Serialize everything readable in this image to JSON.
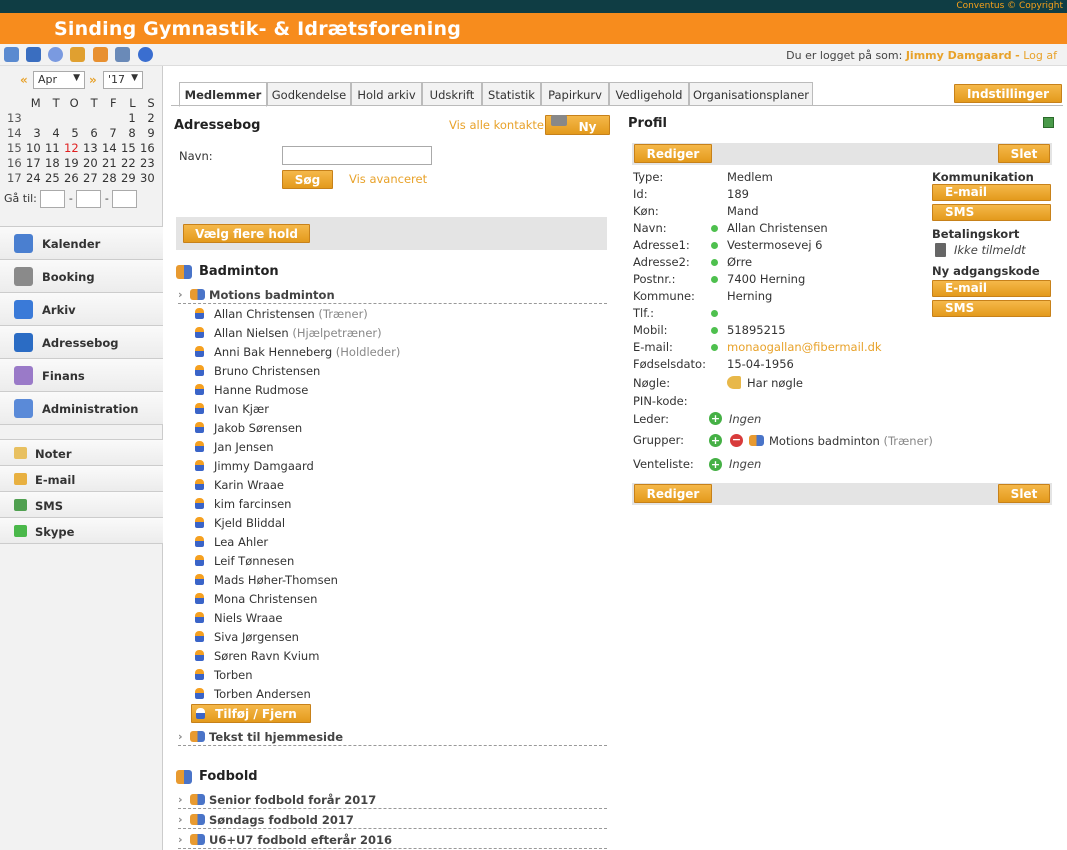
{
  "header": {
    "copyright": "Conventus © Copyright",
    "brand": "Sinding Gymnastik- & Idrætsforening",
    "login_prefix": "Du er logget på som:",
    "user": "Jimmy Damgaard",
    "logout_sep": "-",
    "logout": "Log af"
  },
  "toolbar": {
    "icons": [
      "calendar-grid-icon",
      "swap-arrows-icon",
      "gear-icon",
      "home-icon",
      "refresh-icon",
      "monitor-icon",
      "help-icon"
    ]
  },
  "calendar": {
    "prev": "«",
    "next": "»",
    "month": "Apr",
    "year": "'17",
    "weekdays": [
      "M",
      "T",
      "O",
      "T",
      "F",
      "L",
      "S"
    ],
    "weeks": [
      {
        "wk": "13",
        "days": [
          "",
          "",
          "",
          "",
          "",
          "1",
          "2"
        ]
      },
      {
        "wk": "14",
        "days": [
          "3",
          "4",
          "5",
          "6",
          "7",
          "8",
          "9"
        ]
      },
      {
        "wk": "15",
        "days": [
          "10",
          "11",
          "12",
          "13",
          "14",
          "15",
          "16"
        ]
      },
      {
        "wk": "16",
        "days": [
          "17",
          "18",
          "19",
          "20",
          "21",
          "22",
          "23"
        ]
      },
      {
        "wk": "17",
        "days": [
          "24",
          "25",
          "26",
          "27",
          "28",
          "29",
          "30"
        ]
      }
    ],
    "today": "12",
    "goto_label": "Gå til:",
    "goto_sep": "-"
  },
  "nav": {
    "main": [
      {
        "label": "Kalender",
        "icon": "calendar-icon",
        "color": "#4a7fd0"
      },
      {
        "label": "Booking",
        "icon": "booking-icon",
        "color": "#8a8a8a"
      },
      {
        "label": "Arkiv",
        "icon": "archive-icon",
        "color": "#3a7ad8"
      },
      {
        "label": "Adressebog",
        "icon": "addressbook-icon",
        "color": "#2b6cc4"
      },
      {
        "label": "Finans",
        "icon": "finance-icon",
        "color": "#9a7ac8"
      },
      {
        "label": "Administration",
        "icon": "admin-icon",
        "color": "#5a8ad8"
      }
    ],
    "secondary": [
      {
        "label": "Noter",
        "icon": "notes-icon",
        "color": "#e8c060"
      },
      {
        "label": "E-mail",
        "icon": "email-icon",
        "color": "#e8b040"
      },
      {
        "label": "SMS",
        "icon": "sms-icon",
        "color": "#50a050"
      },
      {
        "label": "Skype",
        "icon": "skype-icon",
        "color": "#4ab84a"
      }
    ]
  },
  "tabs": [
    "Medlemmer",
    "Godkendelse",
    "Hold arkiv",
    "Udskrift",
    "Statistik",
    "Papirkurv",
    "Vedligehold",
    "Organisationsplaner"
  ],
  "settings_button": "Indstillinger",
  "addressbook": {
    "title": "Adressebog",
    "show_all": "Vis alle kontakter",
    "new": "Ny",
    "name_label": "Navn:",
    "name_value": "",
    "search": "Søg",
    "advanced": "Vis avanceret",
    "select_multiple": "Vælg flere hold"
  },
  "groups": [
    {
      "title": "Badminton",
      "subgroups": [
        {
          "name": "Motions badminton",
          "members": [
            {
              "name": "Allan Christensen",
              "role": "(Træner)"
            },
            {
              "name": "Allan Nielsen",
              "role": "(Hjælpetræner)"
            },
            {
              "name": "Anni Bak Henneberg",
              "role": "(Holdleder)"
            },
            {
              "name": "Bruno Christensen",
              "role": ""
            },
            {
              "name": "Hanne Rudmose",
              "role": ""
            },
            {
              "name": "Ivan Kjær",
              "role": ""
            },
            {
              "name": "Jakob Sørensen",
              "role": ""
            },
            {
              "name": "Jan Jensen",
              "role": ""
            },
            {
              "name": "Jimmy Damgaard",
              "role": ""
            },
            {
              "name": "Karin Wraae",
              "role": ""
            },
            {
              "name": "kim farcinsen",
              "role": ""
            },
            {
              "name": "Kjeld Bliddal",
              "role": ""
            },
            {
              "name": "Lea Ahler",
              "role": ""
            },
            {
              "name": "Leif Tønnesen",
              "role": ""
            },
            {
              "name": "Mads Høher-Thomsen",
              "role": ""
            },
            {
              "name": "Mona Christensen",
              "role": ""
            },
            {
              "name": "Niels Wraae",
              "role": ""
            },
            {
              "name": "Siva Jørgensen",
              "role": ""
            },
            {
              "name": "Søren Ravn Kvium",
              "role": ""
            },
            {
              "name": "Torben",
              "role": ""
            },
            {
              "name": "Torben Andersen",
              "role": ""
            }
          ],
          "add_remove": "Tilføj / Fjern"
        },
        {
          "name": "Tekst til hjemmeside"
        }
      ]
    },
    {
      "title": "Fodbold",
      "subgroups": [
        {
          "name": "Senior fodbold forår 2017"
        },
        {
          "name": "Søndags fodbold 2017"
        },
        {
          "name": "U6+U7 fodbold efterår 2016"
        }
      ]
    }
  ],
  "profile": {
    "title": "Profil",
    "edit": "Rediger",
    "delete": "Slet",
    "rows": [
      {
        "key": "Type:",
        "value": "Medlem",
        "dot": false
      },
      {
        "key": "Id:",
        "value": "189",
        "dot": false
      },
      {
        "key": "Køn:",
        "value": "Mand",
        "dot": false
      },
      {
        "key": "Navn:",
        "value": "Allan Christensen",
        "dot": true
      },
      {
        "key": "Adresse1:",
        "value": "Vestermosevej 6",
        "dot": true
      },
      {
        "key": "Adresse2:",
        "value": "Ørre",
        "dot": true
      },
      {
        "key": "Postnr.:",
        "value": "7400 Herning",
        "dot": true
      },
      {
        "key": "Kommune:",
        "value": "Herning",
        "dot": false
      },
      {
        "key": "Tlf.:",
        "value": "",
        "dot": true
      },
      {
        "key": "Mobil:",
        "value": "51895215",
        "dot": true
      },
      {
        "key": "E-mail:",
        "value": "monaogallan@fibermail.dk",
        "dot": true,
        "link": true
      },
      {
        "key": "Fødselsdato:",
        "value": "15-04-1956",
        "dot": false
      },
      {
        "key": "Nøgle:",
        "value": "Har nøgle",
        "dot": false,
        "icon": "key-icon"
      },
      {
        "key": "PIN-kode:",
        "value": "",
        "dot": false
      }
    ],
    "leader_label": "Leder:",
    "leader_value": "Ingen",
    "groups_label": "Grupper:",
    "groups_value": "Motions badminton",
    "groups_role": "(Træner)",
    "waitlist_label": "Venteliste:",
    "waitlist_value": "Ingen",
    "communication": "Kommunikation",
    "email_btn": "E-mail",
    "sms_btn": "SMS",
    "payment_card": "Betalingskort",
    "payment_value": "Ikke tilmeldt",
    "new_password": "Ny adgangskode"
  }
}
